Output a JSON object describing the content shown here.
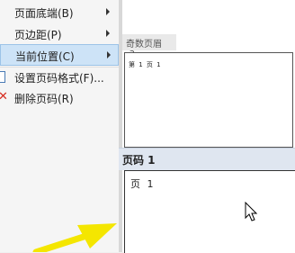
{
  "menu": {
    "items": [
      {
        "label": "页面底端(B)",
        "has_submenu": true
      },
      {
        "label": "页边距(P)",
        "has_submenu": true
      },
      {
        "label": "当前位置(C)",
        "has_submenu": true,
        "active": true
      },
      {
        "label": "设置页码格式(F)...",
        "has_submenu": false
      },
      {
        "label": "删除页码(R)",
        "has_submenu": false
      }
    ]
  },
  "document": {
    "header_tab_label": "奇数页眉 -3-",
    "top_page_text": "第 1 页 1",
    "footer_label": "页码 1",
    "footer_text": "页 1"
  },
  "colors": {
    "active_item": "#cde3f7",
    "footer_band": "#dfe6f0",
    "delete_icon": "#d62b1f",
    "arrow": "#f4e600"
  },
  "icons": {
    "format_icon": "page-number-format-icon",
    "delete_icon": "delete-x-icon",
    "pointer": "mouse-pointer-icon",
    "callout": "yellow-arrow-icon"
  }
}
